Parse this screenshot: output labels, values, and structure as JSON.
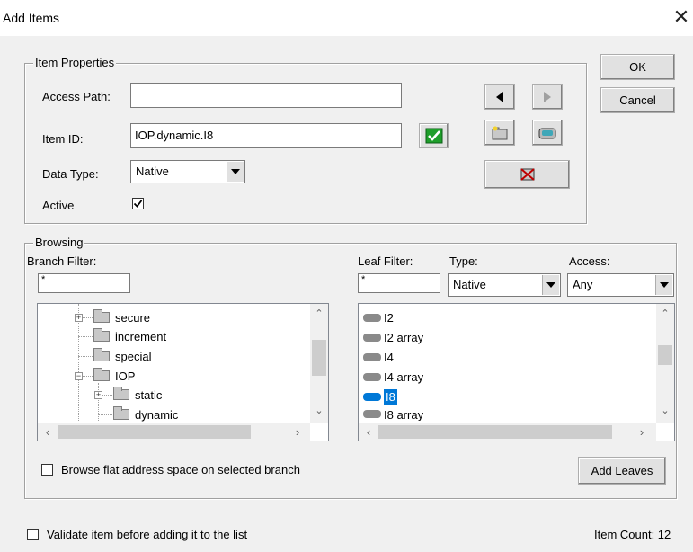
{
  "window": {
    "title": "Add Items",
    "close_glyph": "✕"
  },
  "props": {
    "group_label": "Item Properties",
    "access_path_label": "Access Path:",
    "access_path_value": "",
    "item_id_label": "Item ID:",
    "item_id_value": "IOP.dynamic.I8",
    "data_type_label": "Data Type:",
    "data_type_value": "Native",
    "active_label": "Active",
    "active_checked": true
  },
  "buttons": {
    "ok": "OK",
    "cancel": "Cancel",
    "add_leaves": "Add Leaves"
  },
  "browsing": {
    "group_label": "Browsing",
    "branch_filter_label": "Branch Filter:",
    "branch_filter_value": "*",
    "leaf_filter_label": "Leaf Filter:",
    "leaf_filter_value": "*",
    "type_label": "Type:",
    "type_value": "Native",
    "access_label": "Access:",
    "access_value": "Any",
    "tree": [
      "secure",
      "increment",
      "special",
      "IOP",
      "static",
      "dynamic"
    ],
    "leaves": [
      "I2",
      "I2 array",
      "I4",
      "I4 array",
      "I8",
      "I8 array"
    ],
    "selected_leaf": "I8",
    "browse_flat_label": "Browse flat address space on selected branch",
    "browse_flat_checked": false
  },
  "footer": {
    "validate_label": "Validate item before adding it to the list",
    "validate_checked": false,
    "item_count": "Item Count: 12"
  },
  "colors": {
    "selection": "#0078d7",
    "check_green": "#1e9e2a"
  }
}
